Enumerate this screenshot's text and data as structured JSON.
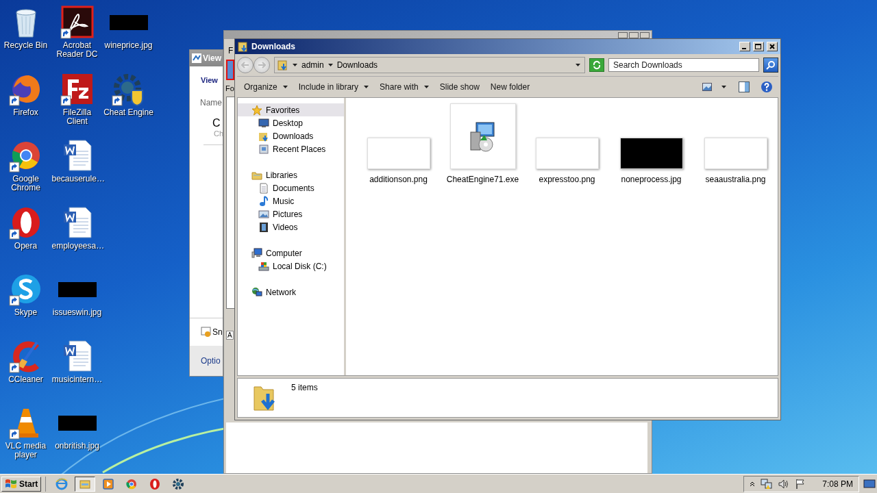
{
  "desktop_icons": [
    {
      "label": "Recycle Bin",
      "kind": "recycle",
      "shortcut": false
    },
    {
      "label": "Firefox",
      "kind": "firefox",
      "shortcut": true
    },
    {
      "label": "Google Chrome",
      "kind": "chrome",
      "shortcut": true
    },
    {
      "label": "Opera",
      "kind": "opera",
      "shortcut": true
    },
    {
      "label": "Skype",
      "kind": "skype",
      "shortcut": true
    },
    {
      "label": "CCleaner",
      "kind": "ccleaner",
      "shortcut": true
    },
    {
      "label": "VLC media player",
      "kind": "vlc",
      "shortcut": true
    },
    {
      "label": "Acrobat Reader DC",
      "kind": "acrobat",
      "shortcut": true
    },
    {
      "label": "FileZilla Client",
      "kind": "filezilla",
      "shortcut": true
    },
    {
      "label": "becauserule…",
      "kind": "word",
      "shortcut": false
    },
    {
      "label": "employeesa…",
      "kind": "word",
      "shortcut": false
    },
    {
      "label": "issueswin.jpg",
      "kind": "image-dark",
      "shortcut": false
    },
    {
      "label": "musicintern…",
      "kind": "word",
      "shortcut": false
    },
    {
      "label": "onbritish.jpg",
      "kind": "image-dark",
      "shortcut": false
    },
    {
      "label": "wineprice.jpg",
      "kind": "image-dark",
      "shortcut": false
    },
    {
      "label": "Cheat Engine",
      "kind": "cheatengine",
      "shortcut": true
    }
  ],
  "view_window": {
    "title": "View",
    "link": "View",
    "column_header": "Name",
    "heading": "C",
    "subtext": "Ch",
    "checkbox_label": "Sn",
    "footer_link": "Optio"
  },
  "cheat_engine_window": {
    "menu": "F",
    "label": "Fo",
    "tab": "A"
  },
  "explorer": {
    "title": "Downloads",
    "breadcrumbs": [
      "admin",
      "Downloads"
    ],
    "search": {
      "placeholder": "Search Downloads"
    },
    "toolbar": [
      {
        "label": "Organize",
        "dropdown": true
      },
      {
        "label": "Include in library",
        "dropdown": true
      },
      {
        "label": "Share with",
        "dropdown": true
      },
      {
        "label": "Slide show",
        "dropdown": false
      },
      {
        "label": "New folder",
        "dropdown": false
      }
    ],
    "nav": [
      {
        "label": "Favorites",
        "kind": "star",
        "selected": true,
        "children": [
          {
            "label": "Desktop",
            "kind": "desktop",
            "selected": false
          },
          {
            "label": "Downloads",
            "kind": "downloads",
            "selected": false
          },
          {
            "label": "Recent Places",
            "kind": "recent",
            "selected": false
          }
        ]
      },
      {
        "label": "Libraries",
        "kind": "library",
        "selected": false,
        "children": [
          {
            "label": "Documents",
            "kind": "documents",
            "selected": false
          },
          {
            "label": "Music",
            "kind": "music",
            "selected": false
          },
          {
            "label": "Pictures",
            "kind": "pictures",
            "selected": false
          },
          {
            "label": "Videos",
            "kind": "videos",
            "selected": false
          }
        ]
      },
      {
        "label": "Computer",
        "kind": "computer",
        "selected": false,
        "children": [
          {
            "label": "Local Disk (C:)",
            "kind": "disk",
            "selected": false
          }
        ]
      },
      {
        "label": "Network",
        "kind": "network",
        "selected": false
      }
    ],
    "files": [
      {
        "name": "additionson.png",
        "kind": "image-light"
      },
      {
        "name": "CheatEngine71.exe",
        "kind": "installer"
      },
      {
        "name": "expresstoo.png",
        "kind": "image-light"
      },
      {
        "name": "noneprocess.jpg",
        "kind": "image-dark"
      },
      {
        "name": "seaaustralia.png",
        "kind": "image-light"
      }
    ],
    "details": {
      "count": "5 items"
    }
  },
  "taskbar": {
    "start": "Start",
    "apps": [
      {
        "kind": "ie",
        "selected": false
      },
      {
        "kind": "explorer",
        "selected": true
      },
      {
        "kind": "player",
        "selected": false
      },
      {
        "kind": "chrome",
        "selected": false
      },
      {
        "kind": "opera",
        "selected": false
      },
      {
        "kind": "cheatengine",
        "selected": false
      }
    ],
    "clock": "7:08 PM"
  }
}
